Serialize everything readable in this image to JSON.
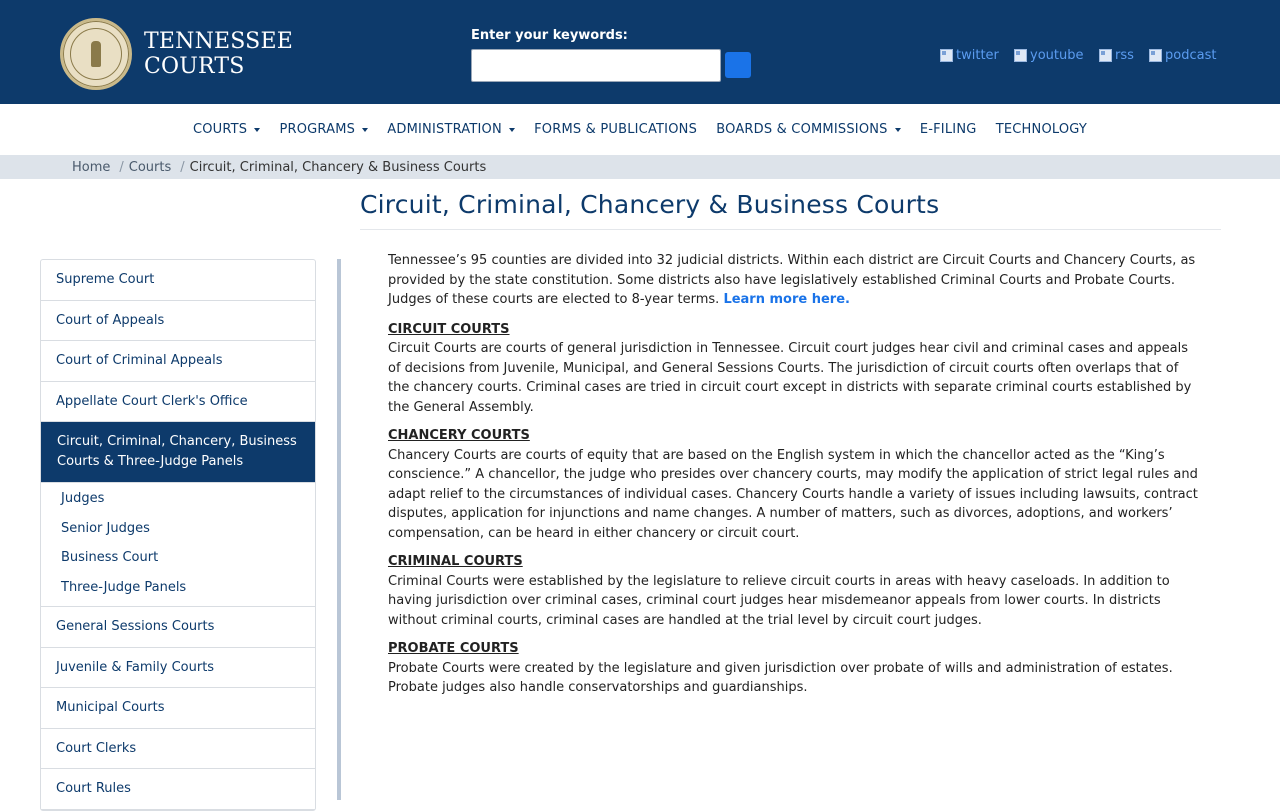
{
  "header": {
    "brand_line1": "TENNESSEE",
    "brand_line2": "COURTS",
    "search_label": "Enter your keywords:",
    "search_value": "",
    "social": [
      {
        "label": "twitter",
        "icon": "twitter-icon"
      },
      {
        "label": "youtube",
        "icon": "youtube-icon"
      },
      {
        "label": "rss",
        "icon": "rss-icon"
      },
      {
        "label": "podcast",
        "icon": "podcast-icon"
      }
    ]
  },
  "nav": {
    "items": [
      {
        "label": "COURTS",
        "dropdown": true
      },
      {
        "label": "PROGRAMS",
        "dropdown": true
      },
      {
        "label": "ADMINISTRATION",
        "dropdown": true
      },
      {
        "label": "FORMS & PUBLICATIONS",
        "dropdown": false
      },
      {
        "label": "BOARDS & COMMISSIONS",
        "dropdown": true
      },
      {
        "label": "E-FILING",
        "dropdown": false
      },
      {
        "label": "TECHNOLOGY",
        "dropdown": false
      }
    ]
  },
  "breadcrumb": {
    "items": [
      "Home",
      "Courts",
      "Circuit, Criminal, Chancery & Business Courts"
    ]
  },
  "page": {
    "title": "Circuit, Criminal, Chancery & Business Courts"
  },
  "sidebar": {
    "items": [
      "Supreme Court",
      "Court of Appeals",
      "Court of Criminal Appeals",
      "Appellate Court Clerk's Office",
      "Circuit, Criminal, Chancery, Business Courts & Three-Judge Panels",
      "General Sessions Courts",
      "Juvenile & Family Courts",
      "Municipal Courts",
      "Court Clerks",
      "Court Rules"
    ],
    "sub_items": [
      "Judges",
      "Senior Judges",
      "Business Court",
      "Three-Judge Panels"
    ]
  },
  "content": {
    "intro": "Tennessee’s 95 counties are divided into 32 judicial districts. Within each district are Circuit Courts and Chancery Courts, as provided by the state constitution. Some districts also have legislatively established Criminal Courts and Probate Courts. Judges of these courts are elected to 8-year terms. ",
    "learn_more": "Learn more here.",
    "sections": [
      {
        "heading": "CIRCUIT COURTS",
        "body": "Circuit Courts are courts of general jurisdiction in Tennessee. Circuit court judges hear civil and criminal cases and appeals of decisions from Juvenile, Municipal, and General Sessions Courts. The jurisdiction of circuit courts often overlaps that of the chancery courts. Criminal cases are tried in circuit court except in districts with separate criminal courts established by the General Assembly."
      },
      {
        "heading": "CHANCERY COURTS",
        "body": "Chancery Courts are courts of equity that are based on the English system in which the chancellor acted as the “King’s conscience.” A chancellor, the judge who presides over chancery courts, may modify the application of strict legal rules and adapt relief to the circumstances of individual cases. Chancery Courts handle a variety of issues including lawsuits, contract disputes, application for injunctions and name changes. A number of matters, such as divorces, adoptions, and workers’ compensation, can be heard in either chancery or circuit court."
      },
      {
        "heading": "CRIMINAL COURTS",
        "body": "Criminal Courts were established by the legislature to relieve circuit courts in areas with heavy caseloads. In addition to having jurisdiction over criminal cases, criminal court judges hear misdemeanor appeals from lower courts. In districts without criminal courts, criminal cases are handled at the trial level by circuit court judges."
      },
      {
        "heading": "PROBATE COURTS",
        "body": "Probate Courts were created by the legislature and given jurisdiction over probate of wills and administration of estates. Probate judges also handle conservatorships and guardianships."
      }
    ]
  },
  "colors": {
    "header_bg": "#0d3a6b",
    "accent": "#1a73e8",
    "breadcrumb_bg": "#dde3ea"
  }
}
